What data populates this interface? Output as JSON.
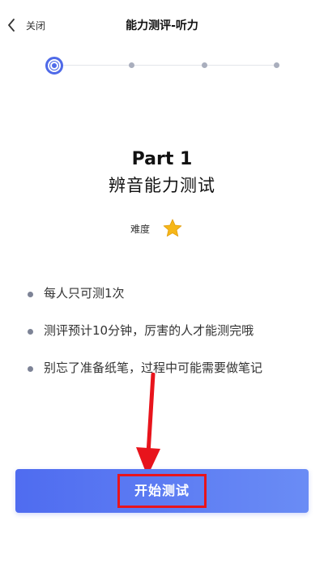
{
  "header": {
    "back_label": "关闭",
    "title": "能力测评-听力"
  },
  "stepper": {
    "total_steps": 4,
    "current_step": 1
  },
  "content": {
    "part_title": "Part 1",
    "section_title": "辨音能力测试",
    "difficulty_label": "难度",
    "difficulty_stars": 1
  },
  "notes": [
    "每人只可测1次",
    "测评预计10分钟，厉害的人才能测完哦",
    "别忘了准备纸笔，过程中可能需要做笔记"
  ],
  "start_button": {
    "label": "开始测试"
  },
  "colors": {
    "accent": "#4f6ae8",
    "annotation": "#e8141c",
    "star": "#f6b718"
  }
}
